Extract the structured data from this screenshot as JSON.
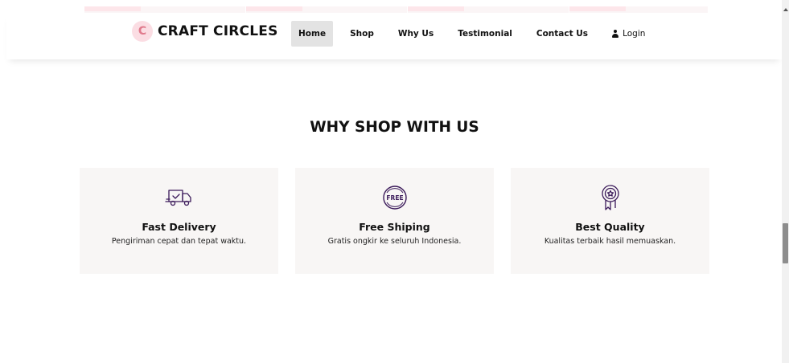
{
  "brand": {
    "name": "CRAFT CIRCLES",
    "logo_icon": "craft-circles-logo-icon"
  },
  "nav": {
    "items": [
      {
        "label": "Home",
        "active": true
      },
      {
        "label": "Shop",
        "active": false
      },
      {
        "label": "Why Us",
        "active": false
      },
      {
        "label": "Testimonial",
        "active": false
      },
      {
        "label": "Contact Us",
        "active": false
      }
    ],
    "login_label": "Login",
    "login_icon": "user-icon"
  },
  "section": {
    "title": "WHY SHOP WITH US",
    "cards": [
      {
        "icon": "delivery-truck-icon",
        "title": "Fast Delivery",
        "desc": "Pengiriman cepat dan tepat waktu."
      },
      {
        "icon": "free-badge-icon",
        "title": "Free Shiping",
        "desc": "Gratis ongkir ke seluruh Indonesia."
      },
      {
        "icon": "award-ribbon-icon",
        "title": "Best Quality",
        "desc": "Kualitas terbaik hasil memuaskan."
      }
    ]
  },
  "colors": {
    "accent_purple": "#3b1a5a",
    "logo_pink": "#fbdde3",
    "card_bg": "#f8f6f5",
    "active_nav_bg": "#e3e3e3"
  }
}
